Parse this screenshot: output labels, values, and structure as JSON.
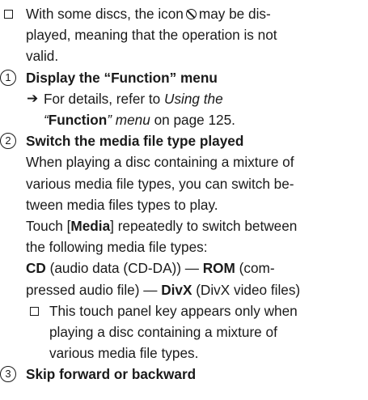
{
  "note1": {
    "line1_a": "With some discs, the icon",
    "line1_b": "may be dis-",
    "line2": "played, meaning that the operation is not",
    "line3": "valid.",
    "icon": "prohibited-icon"
  },
  "item1": {
    "number": "1",
    "heading": "Display the “Function” menu",
    "ref_prefix": "For details, refer to",
    "ref_link_a": "Using the",
    "ref_link_b_open": "“",
    "ref_link_b_bold": "Function",
    "ref_link_b_close": "” menu",
    "ref_suffix": "on page 125."
  },
  "item2": {
    "number": "2",
    "heading": "Switch the media file type played",
    "p1_l1": "When playing a disc containing a mixture of",
    "p1_l2": "various media file types, you can switch be-",
    "p1_l3": "tween media files types to play.",
    "p2_l1_a": "Touch [",
    "p2_l1_b": "Media",
    "p2_l1_c": "] repeatedly to switch between",
    "p2_l2": "the following media file types:",
    "p3_cd": "CD",
    "p3_cd_desc": "(audio data (CD-DA)) —",
    "p3_rom": "ROM",
    "p3_rom_desc": "(com-",
    "p3_l2_a": "pressed audio file) —",
    "p3_divx": "DivX",
    "p3_l2_b": "(DivX video files)",
    "note_l1": "This touch panel key appears only when",
    "note_l2": "playing a disc containing a mixture of",
    "note_l3": "various media file types."
  },
  "item3": {
    "number": "3",
    "heading": "Skip forward or backward"
  }
}
